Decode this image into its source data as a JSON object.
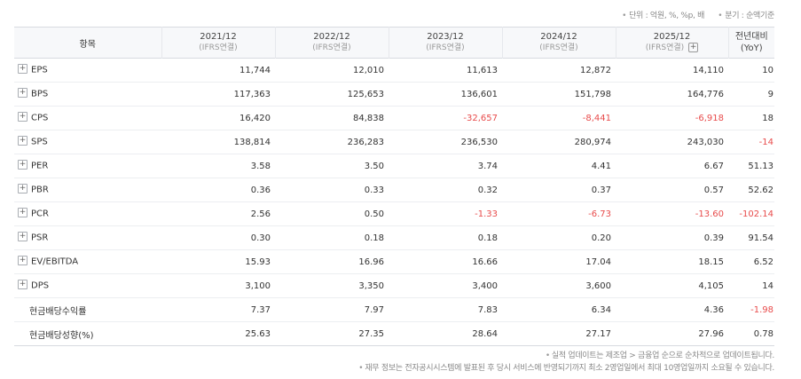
{
  "units": {
    "unit": "단위 : 억원, %, %p, 배",
    "period": "분기 : 순액기준"
  },
  "header": {
    "item": "항목",
    "periods": [
      {
        "label": "2021/12",
        "sub": "(IFRS연결)"
      },
      {
        "label": "2022/12",
        "sub": "(IFRS연결)"
      },
      {
        "label": "2023/12",
        "sub": "(IFRS연결)"
      },
      {
        "label": "2024/12",
        "sub": "(IFRS연결)"
      },
      {
        "label": "2025/12",
        "sub": "(IFRS연결)"
      }
    ],
    "expand_symbol": "+",
    "yoy_line1": "전년대비",
    "yoy_line2": "(YoY)"
  },
  "rows": [
    {
      "label": "EPS",
      "values": [
        "11,744",
        "12,010",
        "11,613",
        "12,872",
        "14,110"
      ],
      "yoy": "10"
    },
    {
      "label": "BPS",
      "values": [
        "117,363",
        "125,653",
        "136,601",
        "151,798",
        "164,776"
      ],
      "yoy": "9"
    },
    {
      "label": "CPS",
      "values": [
        "16,420",
        "84,838",
        "-32,657",
        "-8,441",
        "-6,918"
      ],
      "yoy": "18"
    },
    {
      "label": "SPS",
      "values": [
        "138,814",
        "236,283",
        "236,530",
        "280,974",
        "243,030"
      ],
      "yoy": "-14"
    },
    {
      "label": "PER",
      "values": [
        "3.58",
        "3.50",
        "3.74",
        "4.41",
        "6.67"
      ],
      "yoy": "51.13"
    },
    {
      "label": "PBR",
      "values": [
        "0.36",
        "0.33",
        "0.32",
        "0.37",
        "0.57"
      ],
      "yoy": "52.62"
    },
    {
      "label": "PCR",
      "values": [
        "2.56",
        "0.50",
        "-1.33",
        "-6.73",
        "-13.60"
      ],
      "yoy": "-102.14"
    },
    {
      "label": "PSR",
      "values": [
        "0.30",
        "0.18",
        "0.18",
        "0.20",
        "0.39"
      ],
      "yoy": "91.54"
    },
    {
      "label": "EV/EBITDA",
      "values": [
        "15.93",
        "16.96",
        "16.66",
        "17.04",
        "18.15"
      ],
      "yoy": "6.52"
    },
    {
      "label": "DPS",
      "values": [
        "3,100",
        "3,350",
        "3,400",
        "3,600",
        "4,105"
      ],
      "yoy": "14"
    },
    {
      "label": "현금배당수익률",
      "values": [
        "7.37",
        "7.97",
        "7.83",
        "6.34",
        "4.36"
      ],
      "yoy": "-1.98"
    },
    {
      "label": "현금배당성향(%)",
      "values": [
        "25.63",
        "27.35",
        "28.64",
        "27.17",
        "27.96"
      ],
      "yoy": "0.78"
    }
  ],
  "expandable_rows": 10,
  "notes": [
    "실적 업데이트는 제조업 > 금융업 순으로 순차적으로 업데이트됩니다.",
    "재무 정보는 전자공시시스템에 발표된 후 당시 서비스에 반영되기까지 최소 2영업일에서 최대 10영업일까지 소요될 수 있습니다."
  ],
  "colors": {
    "negative": "#e84b4b",
    "header_bg": "#f7f8fa",
    "border": "#d7dae0"
  }
}
